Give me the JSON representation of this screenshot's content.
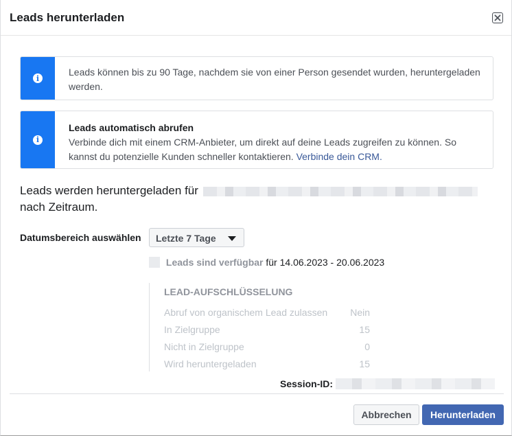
{
  "dialog": {
    "title": "Leads herunterladen"
  },
  "notices": [
    {
      "text": "Leads können bis zu 90 Tage, nachdem sie von einer Person gesendet wurden, heruntergeladen werden."
    },
    {
      "heading": "Leads automatisch abrufen",
      "text": "Verbinde dich mit einem CRM-Anbieter, um direkt auf deine Leads zugreifen zu können. So kannst du potenzielle Kunden schneller kontaktieren.",
      "link": "Verbinde dein CRM."
    }
  ],
  "download_line": {
    "prefix": "Leads werden heruntergeladen für",
    "suffix": "nach Zeitraum."
  },
  "date_range": {
    "label": "Datumsbereich auswählen",
    "selected": "Letzte 7 Tage"
  },
  "availability": {
    "prefix": "Leads sind verfügbar",
    "range": "für 14.06.2023 - 20.06.2023"
  },
  "breakdown": {
    "title": "LEAD-AUFSCHLÜSSELUNG",
    "rows": [
      {
        "label": "Abruf von organischem Lead zulassen",
        "value": "Nein"
      },
      {
        "label": "In Zielgruppe",
        "value": "15"
      },
      {
        "label": "Nicht in Zielgruppe",
        "value": "0"
      },
      {
        "label": "Wird heruntergeladen",
        "value": "15"
      }
    ]
  },
  "session": {
    "label": "Session-ID:"
  },
  "footer": {
    "cancel_label": "Abbrechen",
    "download_label": "Herunterladen"
  },
  "colors": {
    "accent": "#1877f2",
    "primary_button": "#4267b2",
    "link": "#385898"
  },
  "icons": {
    "info": "info-icon",
    "close": "close-icon",
    "caret": "caret-down-icon"
  }
}
